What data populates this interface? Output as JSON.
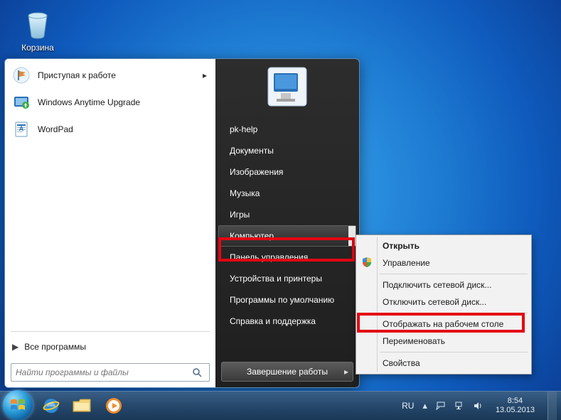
{
  "desktop": {
    "recycle_bin_label": "Корзина"
  },
  "start_menu": {
    "left": {
      "items": [
        {
          "label": "Приступая к работе",
          "has_arrow": true,
          "icon": "flag-icon"
        },
        {
          "label": "Windows Anytime Upgrade",
          "has_arrow": false,
          "icon": "upgrade-icon"
        },
        {
          "label": "WordPad",
          "has_arrow": false,
          "icon": "wordpad-icon"
        }
      ],
      "all_programs": "Все программы"
    },
    "search_placeholder": "Найти программы и файлы",
    "right": {
      "items": [
        "pk-help",
        "Документы",
        "Изображения",
        "Музыка",
        "Игры",
        "Компьютер",
        "Панель управления",
        "Устройства и принтеры",
        "Программы по умолчанию",
        "Справка и поддержка"
      ],
      "selected_index": 5,
      "shutdown_label": "Завершение работы"
    }
  },
  "context_menu": {
    "items": [
      {
        "label": "Открыть",
        "bold": true
      },
      {
        "label": "Управление",
        "icon": "shield-icon"
      },
      {
        "sep": true
      },
      {
        "label": "Подключить сетевой диск..."
      },
      {
        "label": "Отключить сетевой диск..."
      },
      {
        "sep": true
      },
      {
        "label": "Отображать на рабочем столе",
        "highlight": true
      },
      {
        "label": "Переименовать"
      },
      {
        "sep": true
      },
      {
        "label": "Свойства"
      }
    ]
  },
  "taskbar": {
    "language": "RU",
    "time": "8:54",
    "date": "13.05.2013"
  }
}
